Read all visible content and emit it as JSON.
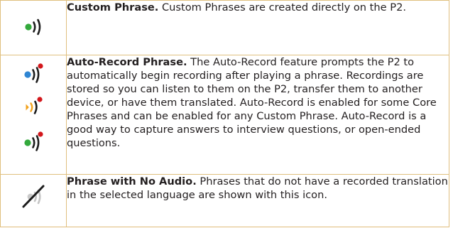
{
  "rows": [
    {
      "icons": [
        "custom-phrase-speaker-icon"
      ],
      "term": "Custom Phrase.",
      "description": " Custom Phrases are created directly on the P2."
    },
    {
      "icons": [
        "auto-record-blue-speaker-icon",
        "auto-record-orange-speaker-icon",
        "auto-record-green-speaker-icon"
      ],
      "term": "Auto-Record Phrase.",
      "description": " The Auto-Record feature prompts the P2 to automatically begin recording after playing a phrase. Recordings are stored so you can listen to them on the P2, transfer them to another device, or have them translated. Auto-Record is enabled for some Core Phrases and can be enabled for any Custom Phrase. Auto-Record is a good way to capture answers to interview questions, or open-ended questions."
    },
    {
      "icons": [
        "no-audio-speaker-icon"
      ],
      "term": "Phrase with No Audio.",
      "description": " Phrases that do not have a recorded translation in the selected language are shown with this icon."
    }
  ],
  "colors": {
    "border": "#e0bf7e",
    "green": "#33a93c",
    "blue": "#2f86d3",
    "orange": "#f3a21c",
    "record_red": "#d3171c",
    "wave_dark": "#1c1c1c"
  }
}
